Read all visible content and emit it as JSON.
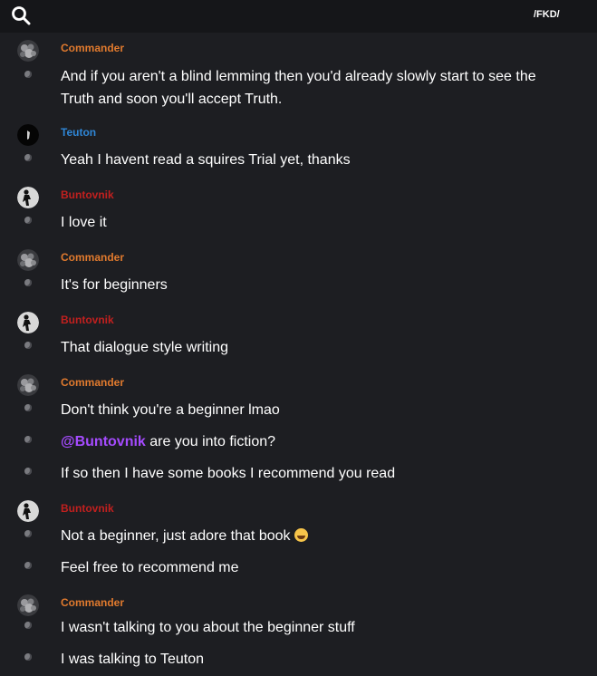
{
  "header": {
    "search_icon": "search-icon",
    "server_tag": "/FKD/"
  },
  "colors": {
    "background": "#1d1e22",
    "topbar": "#151619",
    "commander": "#e07a2e",
    "teuton": "#2f86d6",
    "buntovnik": "#c0201f",
    "mention": "#a54bff",
    "text": "#ffffff"
  },
  "groups": [
    {
      "author": "Commander",
      "role": "commander",
      "avatar": "gray-avatar-icon",
      "messages": [
        {
          "text": "And if  you aren't a blind lemming then you'd already slowly start to see the Truth and soon you'll accept Truth."
        }
      ]
    },
    {
      "author": "Teuton",
      "role": "teuton",
      "avatar": "dark-avatar-icon",
      "messages": [
        {
          "text": "Yeah I havent read a squires Trial yet, thanks"
        }
      ]
    },
    {
      "author": "Buntovnik",
      "role": "buntovnik",
      "avatar": "figure-avatar-icon",
      "messages": [
        {
          "text": "I love it"
        }
      ]
    },
    {
      "author": "Commander",
      "role": "commander",
      "avatar": "gray-avatar-icon",
      "messages": [
        {
          "text": "It's for beginners"
        }
      ]
    },
    {
      "author": "Buntovnik",
      "role": "buntovnik",
      "avatar": "figure-avatar-icon",
      "messages": [
        {
          "text": "That dialogue style writing"
        }
      ]
    },
    {
      "author": "Commander",
      "role": "commander",
      "avatar": "gray-avatar-icon",
      "messages": [
        {
          "text": "Don't think you're a beginner lmao"
        },
        {
          "mention": "@Buntovnik",
          "text": " are you into fiction?"
        },
        {
          "text": "If so then I have some books I recommend you read"
        }
      ]
    },
    {
      "author": "Buntovnik",
      "role": "buntovnik",
      "avatar": "figure-avatar-icon",
      "messages": [
        {
          "text": "Not a beginner, just adore that book",
          "emoji": "laughing-emoji-icon"
        },
        {
          "text": "Feel free to recommend me"
        }
      ]
    },
    {
      "author": "Commander",
      "role": "commander",
      "avatar": "gray-avatar-icon",
      "messages": [
        {
          "text": "I wasn't talking to you about the beginner stuff"
        },
        {
          "text": "I was talking to Teuton"
        }
      ]
    }
  ]
}
